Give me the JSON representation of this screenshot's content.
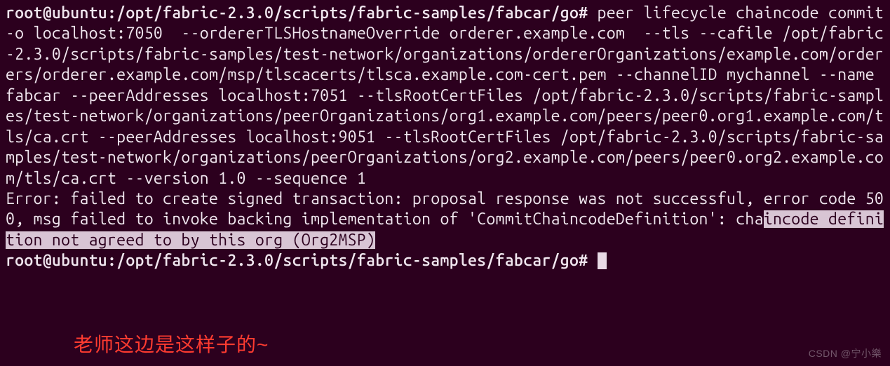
{
  "terminal": {
    "prompt1": "root@ubuntu:/opt/fabric-2.3.0/scripts/fabric-samples/fabcar/go#",
    "command": " peer lifecycle chaincode commit  -o localhost:7050  --ordererTLSHostnameOverride orderer.example.com  --tls --cafile /opt/fabric-2.3.0/scripts/fabric-samples/test-network/organizations/ordererOrganizations/example.com/orderers/orderer.example.com/msp/tlscacerts/tlsca.example.com-cert.pem --channelID mychannel --name fabcar --peerAddresses localhost:7051 --tlsRootCertFiles /opt/fabric-2.3.0/scripts/fabric-samples/test-network/organizations/peerOrganizations/org1.example.com/peers/peer0.org1.example.com/tls/ca.crt --peerAddresses localhost:9051 --tlsRootCertFiles /opt/fabric-2.3.0/scripts/fabric-samples/test-network/organizations/peerOrganizations/org2.example.com/peers/peer0.org2.example.com/tls/ca.crt --version 1.0 --sequence 1",
    "error_prefix": "Error: failed to create signed transaction: proposal response was not successful, error code 500, msg failed to invoke backing implementation of 'CommitChaincodeDefinition': cha",
    "error_highlighted": "incode definition not agreed to by this org (Org2MSP)",
    "prompt2": "root@ubuntu:/opt/fabric-2.3.0/scripts/fabric-samples/fabcar/go# "
  },
  "caption": "老师这边是这样子的~",
  "watermark": "CSDN @宁小樂"
}
